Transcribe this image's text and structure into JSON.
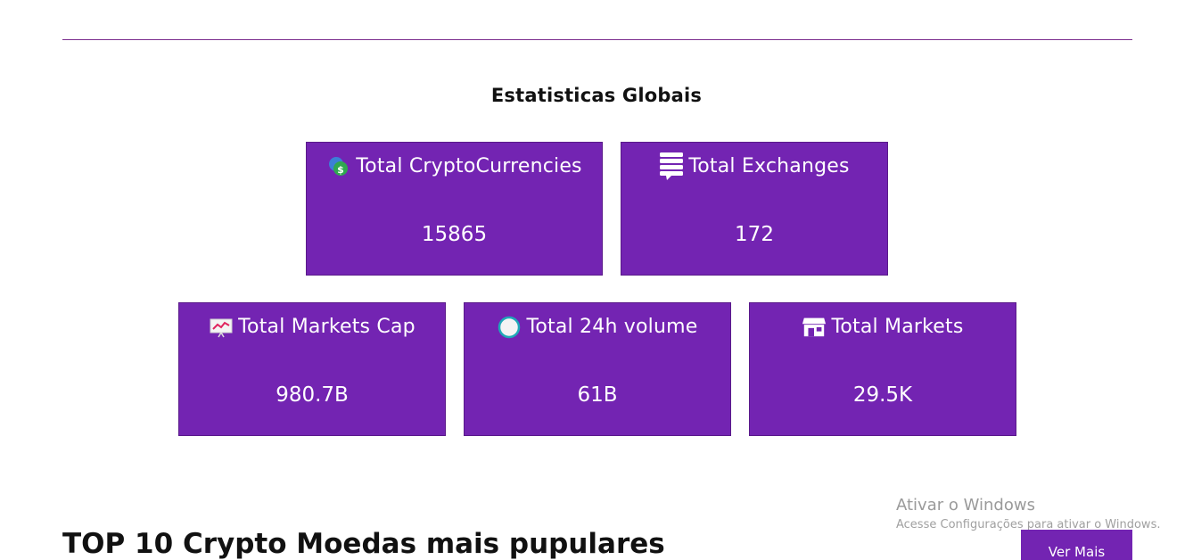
{
  "section_title": "Estatisticas Globais",
  "cards": [
    {
      "label": "Total CryptoCurrencies",
      "value": "15865",
      "icon": "coins-dollar-icon"
    },
    {
      "label": "Total Exchanges",
      "value": "172",
      "icon": "exchange-list-icon"
    },
    {
      "label": "Total Markets Cap",
      "value": "980.7B",
      "icon": "chart-board-icon"
    },
    {
      "label": "Total 24h volume",
      "value": "61B",
      "icon": "clock-icon"
    },
    {
      "label": "Total Markets",
      "value": "29.5K",
      "icon": "store-icon"
    }
  ],
  "watermark": {
    "title": "Ativar o Windows",
    "subtitle": "Acesse Configurações para ativar o Windows."
  },
  "top10_heading": "TOP 10 Crypto Moedas mais pupulares",
  "see_more_label": "Ver Mais",
  "colors": {
    "card_bg": "#7324b2",
    "rule": "#7b2d8e",
    "text_dark": "#111111"
  }
}
